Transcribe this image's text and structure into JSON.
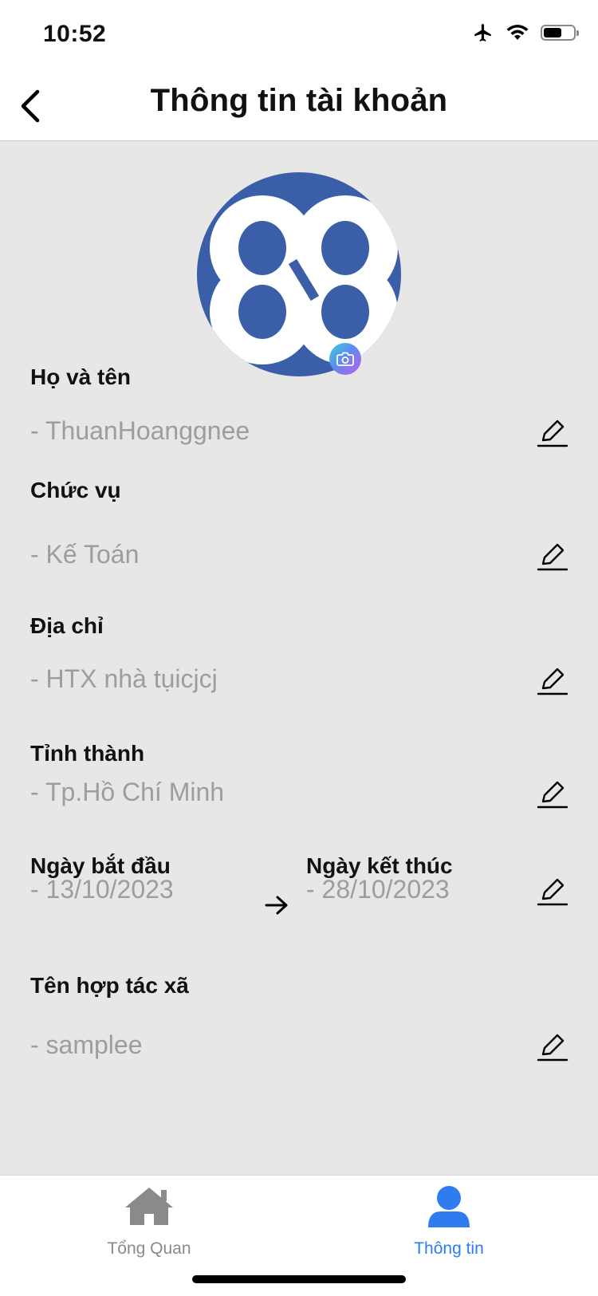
{
  "status_bar": {
    "time": "10:52"
  },
  "nav": {
    "title": "Thông tin tài khoản"
  },
  "fields": {
    "name": {
      "label": "Họ và tên",
      "value": "- ThuanHoanggnee"
    },
    "position": {
      "label": "Chức vụ",
      "value": "- Kế Toán"
    },
    "address": {
      "label": "Địa chỉ",
      "value": "- HTX nhà tụicjcj"
    },
    "province": {
      "label": "Tỉnh thành",
      "value": "- Tp.Hồ Chí Minh"
    },
    "start_date": {
      "label": "Ngày bắt đầu",
      "value": "- 13/10/2023"
    },
    "end_date": {
      "label": "Ngày kết thúc",
      "value": "- 28/10/2023"
    },
    "cooperative": {
      "label": "Tên hợp tác xã",
      "value": "- samplee"
    }
  },
  "tabs": [
    {
      "label": "Tổng Quan",
      "icon": "home-icon",
      "active": false
    },
    {
      "label": "Thông tin",
      "icon": "user-icon",
      "active": true
    }
  ],
  "colors": {
    "accent": "#2f7cf0",
    "avatar_bg": "#3a5ea8",
    "inactive_tab": "#8a8a8a",
    "content_bg": "#e7e7e7",
    "value_text": "#9d9d9d"
  }
}
